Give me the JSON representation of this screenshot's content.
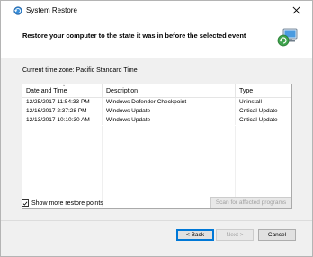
{
  "window": {
    "title": "System Restore",
    "close_icon": "close-icon",
    "app_icon": "system-restore-icon"
  },
  "header": {
    "title": "Restore your computer to the state it was in before the selected event",
    "icon": "system-restore-computer-icon"
  },
  "timezone_label": "Current time zone: Pacific Standard Time",
  "table": {
    "columns": [
      "Date and Time",
      "Description",
      "Type"
    ],
    "rows": [
      {
        "date": "12/25/2017 11:54:33 PM",
        "description": "Windows Defender Checkpoint",
        "type": "Uninstall"
      },
      {
        "date": "12/16/2017 2:37:28 PM",
        "description": "Windows Update",
        "type": "Critical Update"
      },
      {
        "date": "12/13/2017 10:10:30 AM",
        "description": "Windows Update",
        "type": "Critical Update"
      }
    ]
  },
  "show_more": {
    "label": "Show more restore points",
    "checked": true
  },
  "buttons": {
    "scan": "Scan for affected programs",
    "back": "< Back",
    "next": "Next >",
    "cancel": "Cancel"
  },
  "colors": {
    "accent": "#0078d7",
    "window_bg": "#f0f0f0"
  }
}
